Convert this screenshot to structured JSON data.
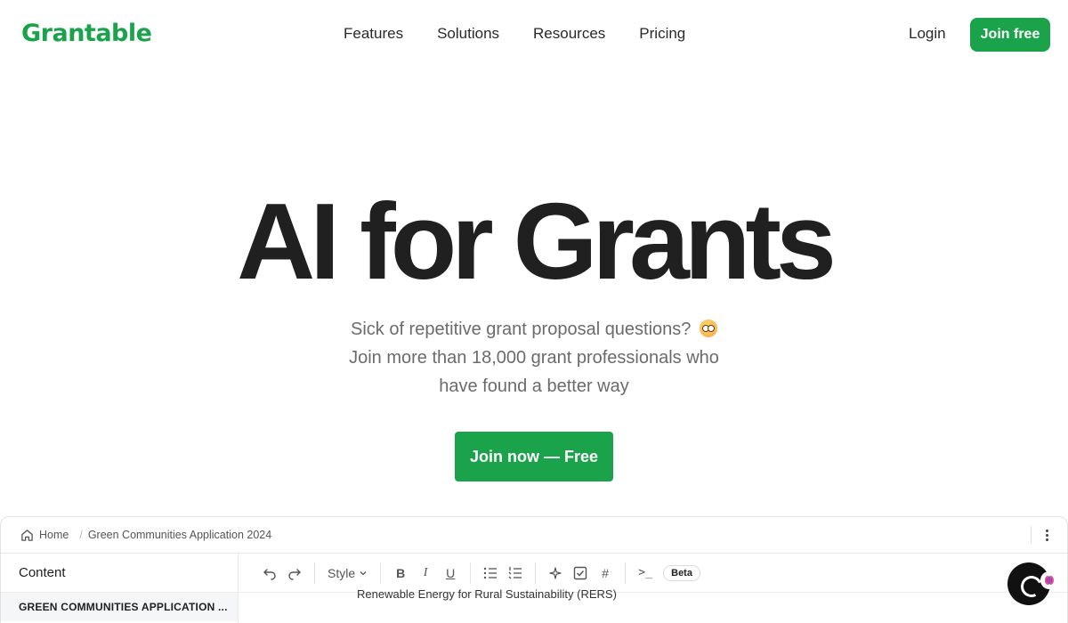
{
  "nav": {
    "logo": "Grantable",
    "links": [
      "Features",
      "Solutions",
      "Resources",
      "Pricing"
    ],
    "login": "Login",
    "join_free": "Join free"
  },
  "hero": {
    "title": "AI for Grants",
    "sub_line1": "Sick of repetitive grant proposal questions?",
    "sub_line2": "Join more than 18,000 grant professionals who",
    "sub_line3": "have found a better way",
    "cta": "Join now — Free"
  },
  "preview": {
    "breadcrumb_home": "Home",
    "breadcrumb_current": "Green Communities Application 2024",
    "sidebar_title": "Content",
    "sidebar_item": "GREEN COMMUNITIES APPLICATION ...",
    "toolbar": {
      "style_label": "Style",
      "bold": "B",
      "italic": "I",
      "underline": "U",
      "hash": "#",
      "terminal": ">_",
      "beta": "Beta"
    },
    "doc_line": "Renewable Energy for Rural Sustainability (RERS)"
  },
  "colors": {
    "brand_green": "#1aa34a",
    "text_dark": "#202020",
    "text_muted": "#6b6b6b"
  }
}
